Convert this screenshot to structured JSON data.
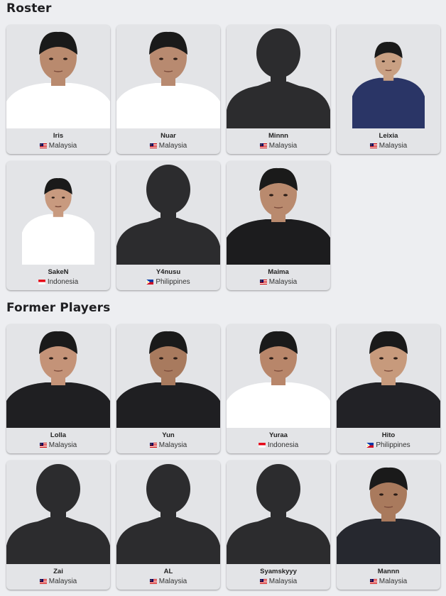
{
  "sections": {
    "roster_title": "Roster",
    "former_title": "Former Players"
  },
  "roster": [
    {
      "name": "Iris",
      "country": "Malaysia",
      "flag": "my",
      "photo": "player-photo",
      "jersey": "#ffffff",
      "skin": "#b98a6e"
    },
    {
      "name": "Nuar",
      "country": "Malaysia",
      "flag": "my",
      "photo": "player-photo",
      "jersey": "#ffffff",
      "skin": "#b88a70"
    },
    {
      "name": "Minnn",
      "country": "Malaysia",
      "flag": "my",
      "photo": "silhouette"
    },
    {
      "name": "Leixia",
      "country": "Malaysia",
      "flag": "my",
      "photo": "player-photo-small",
      "jersey": "#2a3566",
      "skin": "#c9a083"
    },
    {
      "name": "SakeN",
      "country": "Indonesia",
      "flag": "id",
      "photo": "player-photo-small",
      "jersey": "#ffffff",
      "skin": "#c89a7f"
    },
    {
      "name": "Y4nusu",
      "country": "Philippines",
      "flag": "ph",
      "photo": "silhouette"
    },
    {
      "name": "Maima",
      "country": "Malaysia",
      "flag": "my",
      "photo": "player-photo",
      "jersey": "#1c1c1e",
      "skin": "#b98a6e"
    }
  ],
  "former": [
    {
      "name": "Lolla",
      "country": "Malaysia",
      "flag": "my",
      "photo": "player-photo",
      "jersey": "#1f1f22",
      "skin": "#c49378"
    },
    {
      "name": "Yun",
      "country": "Malaysia",
      "flag": "my",
      "photo": "player-photo",
      "jersey": "#1f1f22",
      "skin": "#a87a5e"
    },
    {
      "name": "Yuraa",
      "country": "Indonesia",
      "flag": "id",
      "photo": "player-photo",
      "jersey": "#ffffff",
      "skin": "#b8866a"
    },
    {
      "name": "Hito",
      "country": "Philippines",
      "flag": "ph",
      "photo": "player-photo",
      "jersey": "#222226",
      "skin": "#c79a7c"
    },
    {
      "name": "Zai",
      "country": "Malaysia",
      "flag": "my",
      "photo": "silhouette"
    },
    {
      "name": "AL",
      "country": "Malaysia",
      "flag": "my",
      "photo": "silhouette"
    },
    {
      "name": "Syamskyyy",
      "country": "Malaysia",
      "flag": "my",
      "photo": "silhouette"
    },
    {
      "name": "Mannn",
      "country": "Malaysia",
      "flag": "my",
      "photo": "player-photo",
      "jersey": "#26282f",
      "skin": "#a97a5d"
    }
  ]
}
